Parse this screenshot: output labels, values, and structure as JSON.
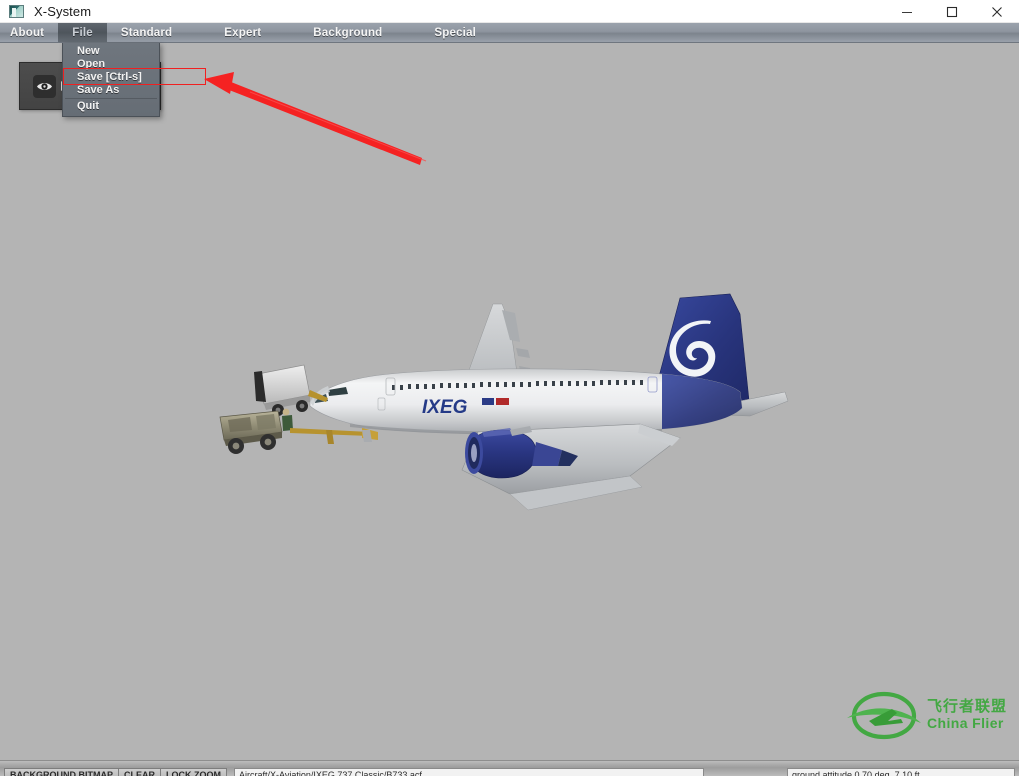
{
  "window": {
    "title": "X-System",
    "icon": "app-icon",
    "controls": [
      {
        "name": "minimize",
        "glyph": "minimize-icon"
      },
      {
        "name": "maximize",
        "glyph": "maximize-icon"
      },
      {
        "name": "close",
        "glyph": "close-icon"
      }
    ]
  },
  "menubar": {
    "items": [
      {
        "label": "About",
        "active": false
      },
      {
        "label": "File",
        "active": true
      },
      {
        "label": "Standard",
        "active": false
      },
      {
        "label": "Expert",
        "active": false
      },
      {
        "label": "Background",
        "active": false
      },
      {
        "label": "Special",
        "active": false
      }
    ]
  },
  "file_menu": {
    "open": true,
    "items": [
      {
        "label": "New"
      },
      {
        "label": "Open"
      },
      {
        "label": "Save [Ctrl-s]"
      },
      {
        "label": "Save As"
      },
      {
        "label": "Quit"
      }
    ],
    "highlighted_item": "Save [Ctrl-s]"
  },
  "view_widget": {
    "eye_icon": "eye-icon",
    "play_icon": "play-triangle-icon"
  },
  "annotation": {
    "color": "#f02020",
    "target": "Save [Ctrl-s]",
    "shapes": [
      "highlight-rectangle",
      "pointer-arrow"
    ]
  },
  "aircraft": {
    "livery_text": "IXEG",
    "tail_logo": "koru-spiral-logo",
    "tail_color": "#2e3f8f",
    "fuselage_color": "#e9e9e9",
    "engine_color": "#2b3b86",
    "ground_vehicles": [
      "catering-truck",
      "tug-truck"
    ]
  },
  "watermark": {
    "logo": "china-flier-logo",
    "color": "#3aa83a",
    "text_cn": "飞行者联盟",
    "text_en": "China Flier"
  },
  "statusbar": {
    "buttons": [
      {
        "label": "BACKGROUND BITMAP"
      },
      {
        "label": "CLEAR"
      },
      {
        "label": "LOCK ZOOM"
      }
    ],
    "path_value": "Aircraft/X-Aviation/IXEG 737 Classic/B733.acf",
    "attitude_value": "ground attitude  0.70 deg,  7.10 ft"
  }
}
